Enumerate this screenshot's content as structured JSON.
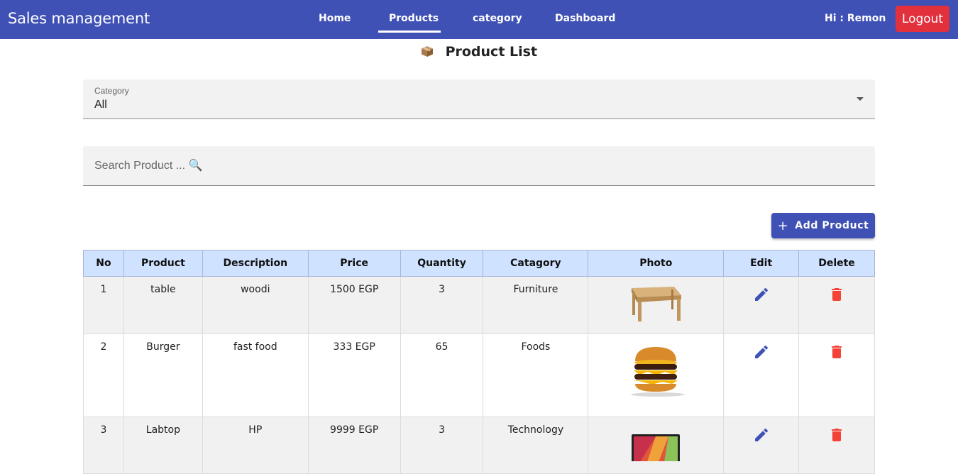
{
  "navbar": {
    "brand": "Sales management",
    "links": [
      "Home",
      "Products",
      "category",
      "Dashboard"
    ],
    "active_link": "Products",
    "greeting": "Hi : Remon",
    "logout_label": "Logout"
  },
  "page": {
    "title": "Product List"
  },
  "filter": {
    "label": "Category",
    "value": "All"
  },
  "search": {
    "placeholder": "Search Product ... 🔍"
  },
  "add_button_label": "Add Product",
  "table": {
    "headers": [
      "No",
      "Product",
      "Description",
      "Price",
      "Quantity",
      "Catagory",
      "Photo",
      "Edit",
      "Delete"
    ],
    "rows": [
      {
        "no": "1",
        "product": "table",
        "description": "woodi",
        "price": "1500 EGP",
        "quantity": "3",
        "category": "Furniture",
        "photo": "wooden-table-image"
      },
      {
        "no": "2",
        "product": "Burger",
        "description": "fast food",
        "price": "333 EGP",
        "quantity": "65",
        "category": "Foods",
        "photo": "burger-image"
      },
      {
        "no": "3",
        "product": "Labtop",
        "description": "HP",
        "price": "9999 EGP",
        "quantity": "3",
        "category": "Technology",
        "photo": "laptop-image"
      }
    ]
  },
  "colors": {
    "navbar": "#3f51b5",
    "logout": "#e2303d",
    "table_header": "#cfe2ff",
    "edit_icon": "#3f51b5",
    "delete_icon": "#f44336"
  },
  "icons": {
    "title": "package-icon",
    "add": "plus-icon",
    "edit": "pencil-icon",
    "delete": "trash-icon",
    "dropdown": "caret-down-icon"
  }
}
